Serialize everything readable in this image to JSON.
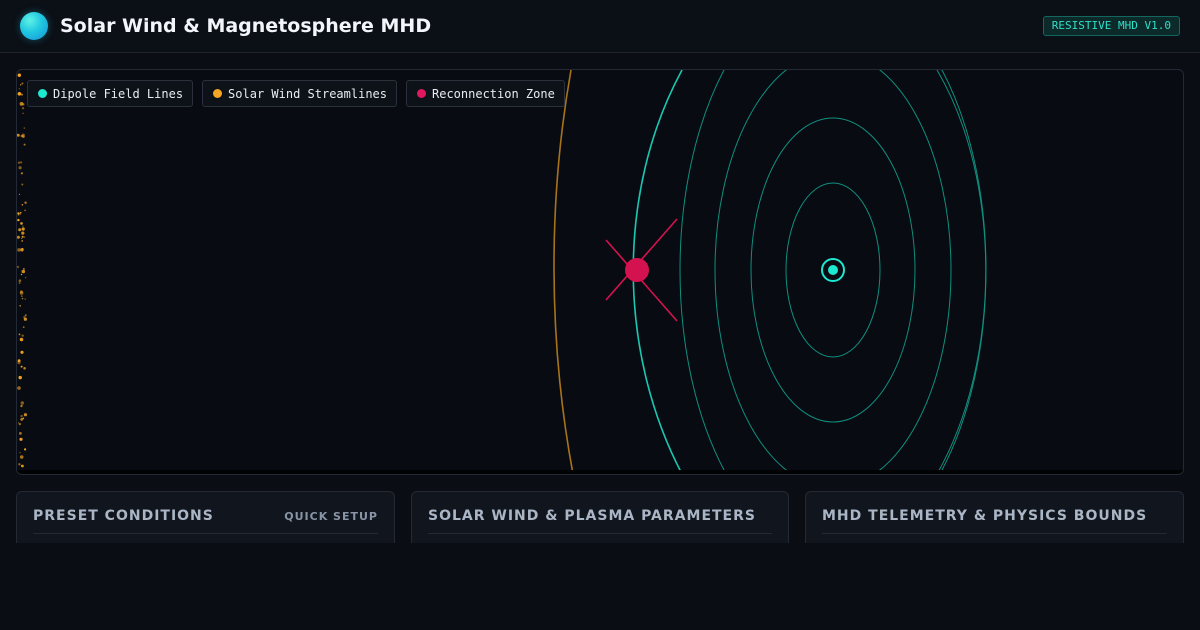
{
  "header": {
    "title": "Solar Wind & Magnetosphere MHD",
    "badge": "RESISTIVE MHD V1.0"
  },
  "legend": [
    {
      "label": "Dipole Field Lines",
      "color": "#1de9d0"
    },
    {
      "label": "Solar Wind Streamlines",
      "color": "#f5a623"
    },
    {
      "label": "Reconnection Zone",
      "color": "#e0195f"
    }
  ],
  "colors": {
    "dipole": "#1de9d0",
    "dipole_outer": "#0f8f7f",
    "wind": "#a8741a",
    "wind_particles": "#f5a623",
    "reconnection": "#d4124f"
  },
  "cards": [
    {
      "title": "PRESET CONDITIONS",
      "subtitle": "QUICK SETUP"
    },
    {
      "title": "SOLAR WIND & PLASMA PARAMETERS",
      "subtitle": ""
    },
    {
      "title": "MHD TELEMETRY & PHYSICS BOUNDS",
      "subtitle": ""
    }
  ]
}
